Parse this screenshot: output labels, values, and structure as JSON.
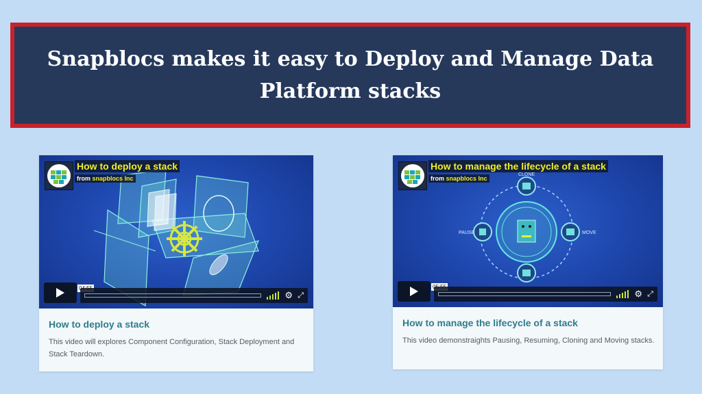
{
  "header": {
    "title": "Snapblocs makes it easy to Deploy and Manage Data Platform stacks"
  },
  "videos": [
    {
      "overlay_title": "How to deploy a stack",
      "from_label": "from",
      "org": "snapblocs Inc",
      "timecode": "04:55",
      "card_title": "How to deploy a stack",
      "description": "This video will explores Component Configuration, Stack Deployment and Stack Teardown."
    },
    {
      "overlay_title": "How to manage the lifecycle of a stack",
      "from_label": "from",
      "org": "snapblocs Inc",
      "timecode": "05:55",
      "labels": {
        "top": "CLONE",
        "left": "PAUSE",
        "right": "MOVE"
      },
      "card_title": "How to manage the lifecycle of a stack",
      "description": "This video demonstraights Pausing, Resuming, Cloning and Moving stacks."
    }
  ],
  "icons": {
    "play": "play-icon",
    "volume": "volume-icon",
    "settings": "gear-icon",
    "fullscreen": "fullscreen-icon"
  },
  "colors": {
    "background": "#c3dcf5",
    "banner_fill": "#26395b",
    "banner_border": "#c8222c",
    "overlay_title": "#f1ef27",
    "card_title": "#2f7c8c"
  }
}
